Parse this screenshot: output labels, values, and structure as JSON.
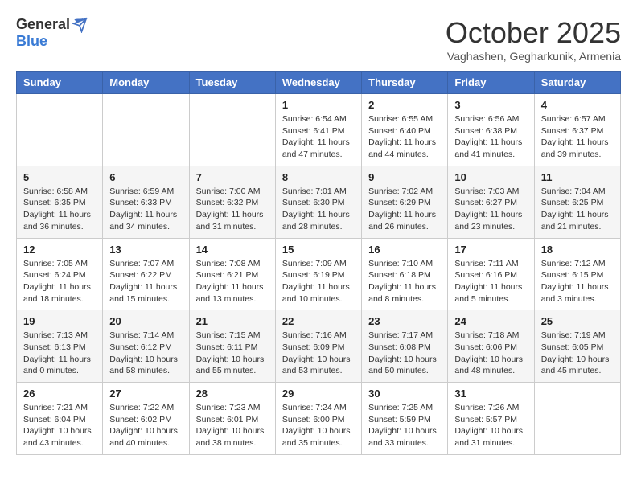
{
  "header": {
    "logo_general": "General",
    "logo_blue": "Blue",
    "month_title": "October 2025",
    "subtitle": "Vaghashen, Gegharkunik, Armenia"
  },
  "calendar": {
    "columns": [
      "Sunday",
      "Monday",
      "Tuesday",
      "Wednesday",
      "Thursday",
      "Friday",
      "Saturday"
    ],
    "weeks": [
      {
        "days": [
          {
            "number": "",
            "info": ""
          },
          {
            "number": "",
            "info": ""
          },
          {
            "number": "",
            "info": ""
          },
          {
            "number": "1",
            "info": "Sunrise: 6:54 AM\nSunset: 6:41 PM\nDaylight: 11 hours and 47 minutes."
          },
          {
            "number": "2",
            "info": "Sunrise: 6:55 AM\nSunset: 6:40 PM\nDaylight: 11 hours and 44 minutes."
          },
          {
            "number": "3",
            "info": "Sunrise: 6:56 AM\nSunset: 6:38 PM\nDaylight: 11 hours and 41 minutes."
          },
          {
            "number": "4",
            "info": "Sunrise: 6:57 AM\nSunset: 6:37 PM\nDaylight: 11 hours and 39 minutes."
          }
        ]
      },
      {
        "days": [
          {
            "number": "5",
            "info": "Sunrise: 6:58 AM\nSunset: 6:35 PM\nDaylight: 11 hours and 36 minutes."
          },
          {
            "number": "6",
            "info": "Sunrise: 6:59 AM\nSunset: 6:33 PM\nDaylight: 11 hours and 34 minutes."
          },
          {
            "number": "7",
            "info": "Sunrise: 7:00 AM\nSunset: 6:32 PM\nDaylight: 11 hours and 31 minutes."
          },
          {
            "number": "8",
            "info": "Sunrise: 7:01 AM\nSunset: 6:30 PM\nDaylight: 11 hours and 28 minutes."
          },
          {
            "number": "9",
            "info": "Sunrise: 7:02 AM\nSunset: 6:29 PM\nDaylight: 11 hours and 26 minutes."
          },
          {
            "number": "10",
            "info": "Sunrise: 7:03 AM\nSunset: 6:27 PM\nDaylight: 11 hours and 23 minutes."
          },
          {
            "number": "11",
            "info": "Sunrise: 7:04 AM\nSunset: 6:25 PM\nDaylight: 11 hours and 21 minutes."
          }
        ]
      },
      {
        "days": [
          {
            "number": "12",
            "info": "Sunrise: 7:05 AM\nSunset: 6:24 PM\nDaylight: 11 hours and 18 minutes."
          },
          {
            "number": "13",
            "info": "Sunrise: 7:07 AM\nSunset: 6:22 PM\nDaylight: 11 hours and 15 minutes."
          },
          {
            "number": "14",
            "info": "Sunrise: 7:08 AM\nSunset: 6:21 PM\nDaylight: 11 hours and 13 minutes."
          },
          {
            "number": "15",
            "info": "Sunrise: 7:09 AM\nSunset: 6:19 PM\nDaylight: 11 hours and 10 minutes."
          },
          {
            "number": "16",
            "info": "Sunrise: 7:10 AM\nSunset: 6:18 PM\nDaylight: 11 hours and 8 minutes."
          },
          {
            "number": "17",
            "info": "Sunrise: 7:11 AM\nSunset: 6:16 PM\nDaylight: 11 hours and 5 minutes."
          },
          {
            "number": "18",
            "info": "Sunrise: 7:12 AM\nSunset: 6:15 PM\nDaylight: 11 hours and 3 minutes."
          }
        ]
      },
      {
        "days": [
          {
            "number": "19",
            "info": "Sunrise: 7:13 AM\nSunset: 6:13 PM\nDaylight: 11 hours and 0 minutes."
          },
          {
            "number": "20",
            "info": "Sunrise: 7:14 AM\nSunset: 6:12 PM\nDaylight: 10 hours and 58 minutes."
          },
          {
            "number": "21",
            "info": "Sunrise: 7:15 AM\nSunset: 6:11 PM\nDaylight: 10 hours and 55 minutes."
          },
          {
            "number": "22",
            "info": "Sunrise: 7:16 AM\nSunset: 6:09 PM\nDaylight: 10 hours and 53 minutes."
          },
          {
            "number": "23",
            "info": "Sunrise: 7:17 AM\nSunset: 6:08 PM\nDaylight: 10 hours and 50 minutes."
          },
          {
            "number": "24",
            "info": "Sunrise: 7:18 AM\nSunset: 6:06 PM\nDaylight: 10 hours and 48 minutes."
          },
          {
            "number": "25",
            "info": "Sunrise: 7:19 AM\nSunset: 6:05 PM\nDaylight: 10 hours and 45 minutes."
          }
        ]
      },
      {
        "days": [
          {
            "number": "26",
            "info": "Sunrise: 7:21 AM\nSunset: 6:04 PM\nDaylight: 10 hours and 43 minutes."
          },
          {
            "number": "27",
            "info": "Sunrise: 7:22 AM\nSunset: 6:02 PM\nDaylight: 10 hours and 40 minutes."
          },
          {
            "number": "28",
            "info": "Sunrise: 7:23 AM\nSunset: 6:01 PM\nDaylight: 10 hours and 38 minutes."
          },
          {
            "number": "29",
            "info": "Sunrise: 7:24 AM\nSunset: 6:00 PM\nDaylight: 10 hours and 35 minutes."
          },
          {
            "number": "30",
            "info": "Sunrise: 7:25 AM\nSunset: 5:59 PM\nDaylight: 10 hours and 33 minutes."
          },
          {
            "number": "31",
            "info": "Sunrise: 7:26 AM\nSunset: 5:57 PM\nDaylight: 10 hours and 31 minutes."
          },
          {
            "number": "",
            "info": ""
          }
        ]
      }
    ]
  }
}
